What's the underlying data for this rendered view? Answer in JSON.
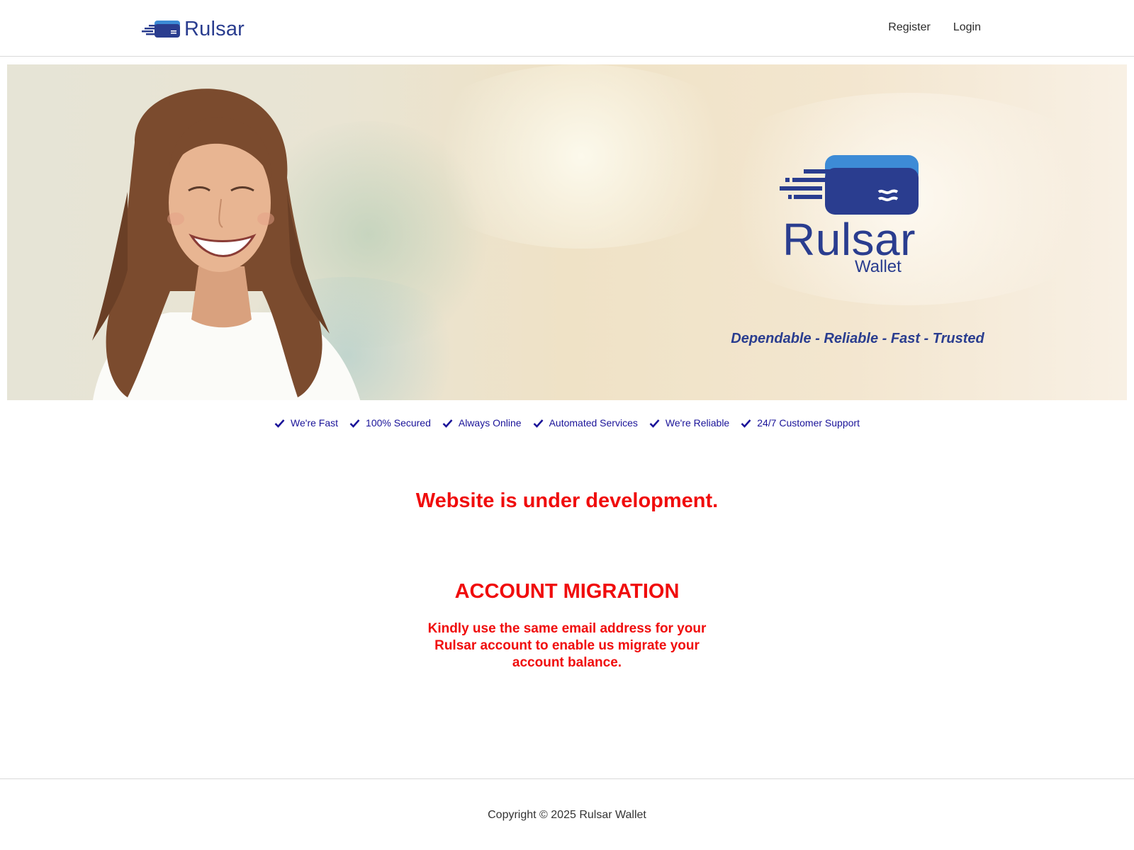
{
  "header": {
    "brand_name": "Rulsar",
    "nav": [
      {
        "label": "Register"
      },
      {
        "label": "Login"
      }
    ]
  },
  "hero": {
    "logo_name": "Rulsar",
    "logo_sub": "Wallet",
    "tagline": "Dependable - Reliable - Fast - Trusted"
  },
  "features": [
    {
      "label": "We're Fast",
      "icon": "check-icon"
    },
    {
      "label": "100% Secured",
      "icon": "check-icon"
    },
    {
      "label": "Always Online",
      "icon": "check-icon"
    },
    {
      "label": "Automated Services",
      "icon": "check-icon"
    },
    {
      "label": "We're Reliable",
      "icon": "check-icon"
    },
    {
      "label": "24/7 Customer Support",
      "icon": "check-icon"
    }
  ],
  "main": {
    "dev_notice": "Website is under development.",
    "migration_title": "ACCOUNT MIGRATION",
    "migration_body": "Kindly use the same email address for your Rulsar account to enable us migrate your account balance."
  },
  "footer": {
    "copyright": "Copyright © 2025 Rulsar Wallet"
  },
  "colors": {
    "brand": "#2a3d8f",
    "brand_light": "#3d8bd6",
    "feature_text": "#1a1399",
    "alert": "#f00c0c"
  }
}
